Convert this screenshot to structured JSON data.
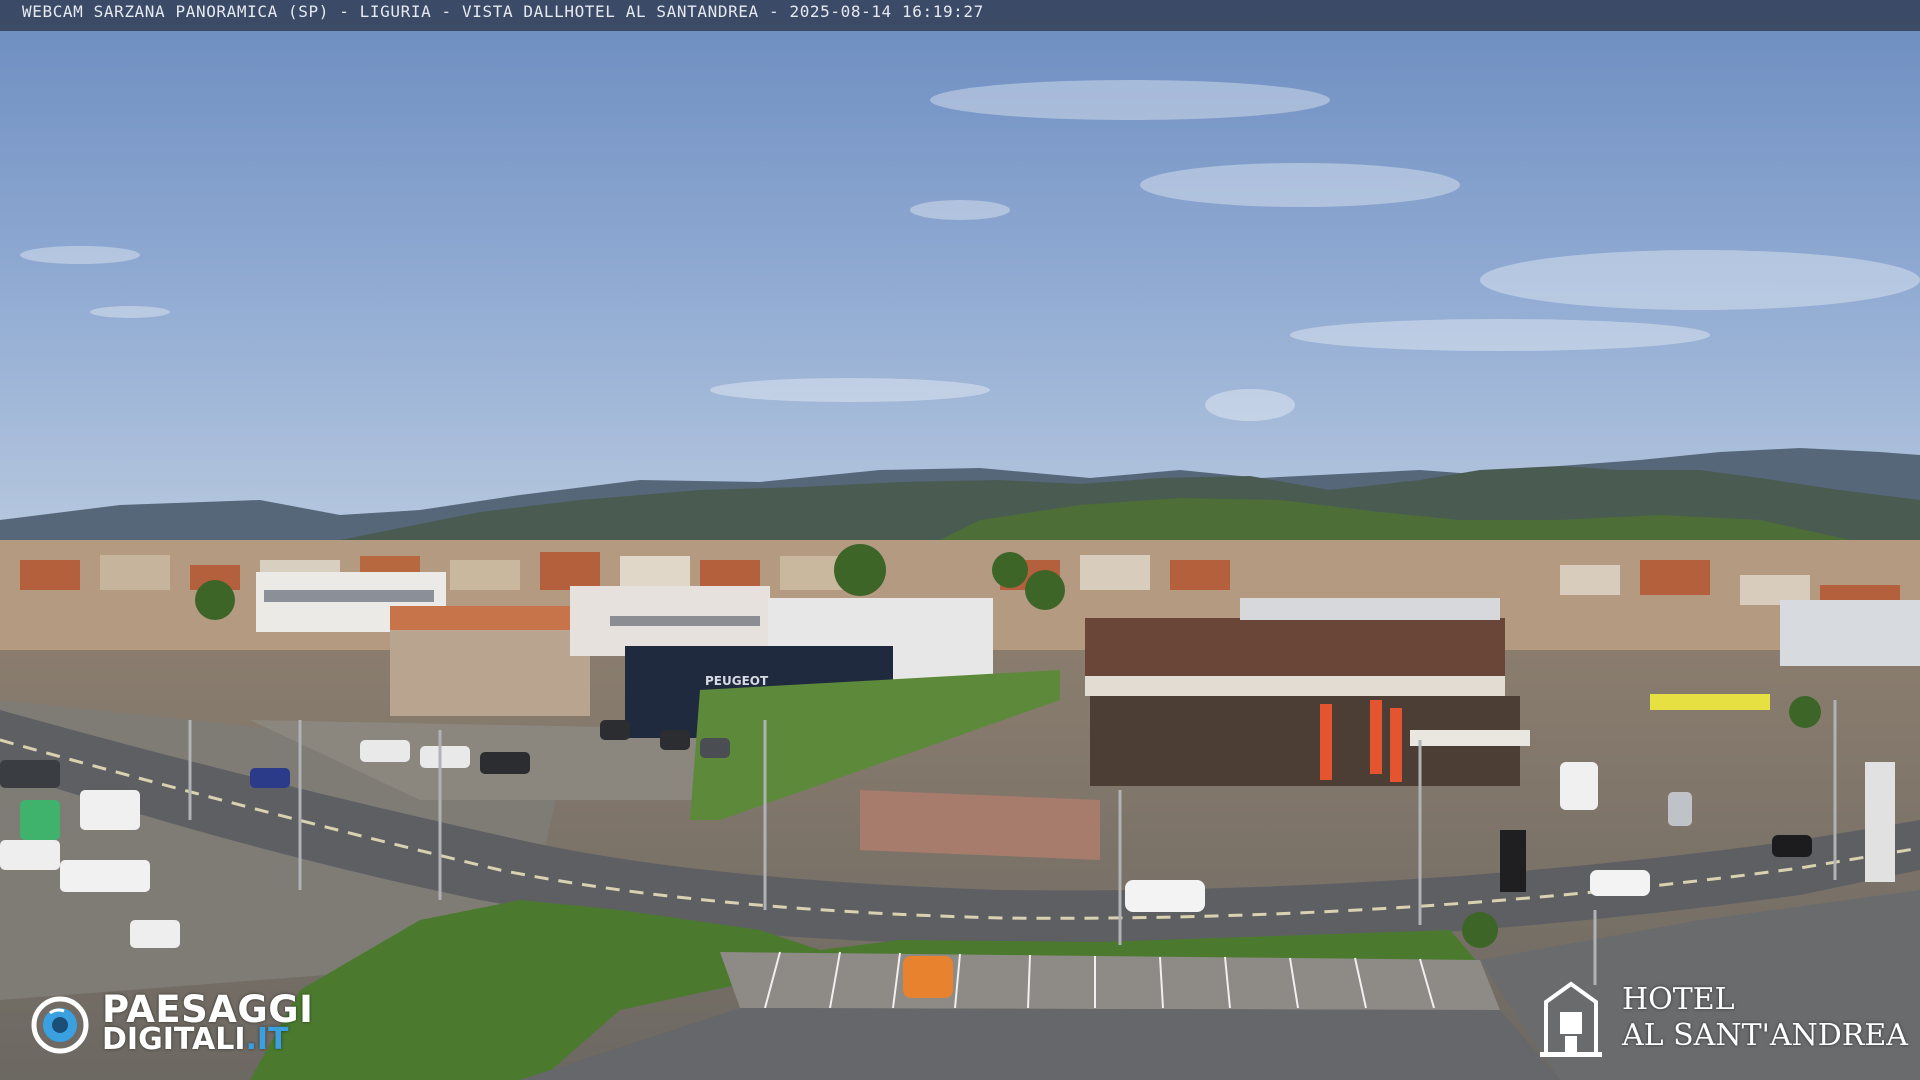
{
  "caption": {
    "text": "WEBCAM SARZANA PANORAMICA (SP) - LIGURIA - VISTA DALLHOTEL AL SANTANDREA - 2025-08-14  16:19:27"
  },
  "watermark_left": {
    "icon": "camera-lens-icon",
    "line1": "PAESAGGI",
    "line2_main": "DIGITALI",
    "line2_tld": ".IT",
    "accent_color": "#3aa0e0"
  },
  "watermark_right": {
    "icon": "hotel-building-icon",
    "line1": "HOTEL",
    "line2": "AL SANT'ANDREA"
  },
  "scene": {
    "sign_dealer": "PEUGEOT",
    "colors": {
      "sky_top": "#6f8fc2",
      "sky_bottom": "#a9bfdc",
      "hills": "#4b5f55",
      "road": "#5f6064",
      "grass": "#4c7a30"
    }
  }
}
